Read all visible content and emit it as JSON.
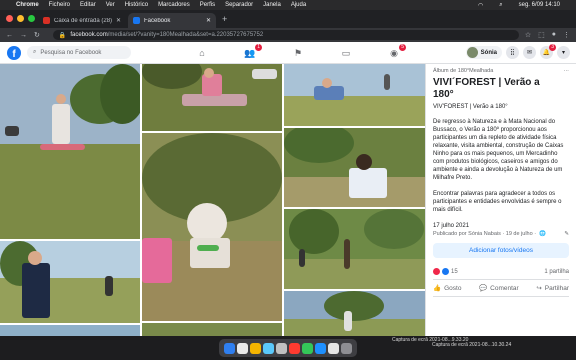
{
  "macos": {
    "apple_icon": "apple-icon",
    "app": "Chrome",
    "menus": [
      "Ficheiro",
      "Editar",
      "Ver",
      "Histórico",
      "Marcadores",
      "Perfis",
      "Separador",
      "Janela",
      "Ajuda"
    ],
    "clock": "seg. 6/09  14:10"
  },
  "browser": {
    "tabs": [
      {
        "label": "Caixa de entrada (28) - sonia...",
        "favicon_color": "#d93025",
        "active": false
      },
      {
        "label": "Facebook",
        "favicon_color": "#1877f2",
        "active": true
      }
    ],
    "new_tab": "+",
    "url_domain": "facebook.com",
    "url_path": "/media/set/?vanity=180Mealhada&set=a.22035727675752"
  },
  "facebook": {
    "logo": "f",
    "search_placeholder": "Pesquisa no Facebook",
    "nav": [
      {
        "icon": "home-icon",
        "glyph": "⌂",
        "badge": ""
      },
      {
        "icon": "friends-icon",
        "glyph": "👥",
        "badge": "1"
      },
      {
        "icon": "flag-icon",
        "glyph": "⚑",
        "badge": ""
      },
      {
        "icon": "marketplace-icon",
        "glyph": "▭",
        "badge": ""
      },
      {
        "icon": "groups-icon",
        "glyph": "◉",
        "badge": "5"
      }
    ],
    "profile_name": "Sónia",
    "notifications_badge": "3"
  },
  "album": {
    "crumb": "Álbum de 180°Mealhada",
    "title": "VIVI´FOREST | Verão a 180°",
    "subtitle": "VIV'FOREST | Verão a 180°",
    "description_1": "De regresso à Natureza e à Mata Nacional do Bussaco, o Verão a 180º proporcionou aos participantes um dia repleto de atividade física relaxante, visita ambiental, construção de Caixas Ninho para os mais pequenos, um Mercadinho com produtos biológicos, caseiros e amigos do ambiente e ainda a devolução à Natureza de um Milhafre Preto.",
    "description_2": "Encontrar palavras para agradecer a todos os participantes e entidades envolvidas é sempre o mais difícil.",
    "date": "17 julho 2021",
    "published_by": "Publicado por Sónia Nabais · 19 de julho ·",
    "add_button": "Adicionar fotos/vídeos",
    "reactions": "15",
    "shares": "1 partilha",
    "like": "Gosto",
    "comment": "Comentar",
    "share": "Partilhar"
  },
  "screenshots": [
    "Captura de ecrã 2021-08...9.33.20",
    "Captura de ecrã 2021-08...10.30.24"
  ]
}
